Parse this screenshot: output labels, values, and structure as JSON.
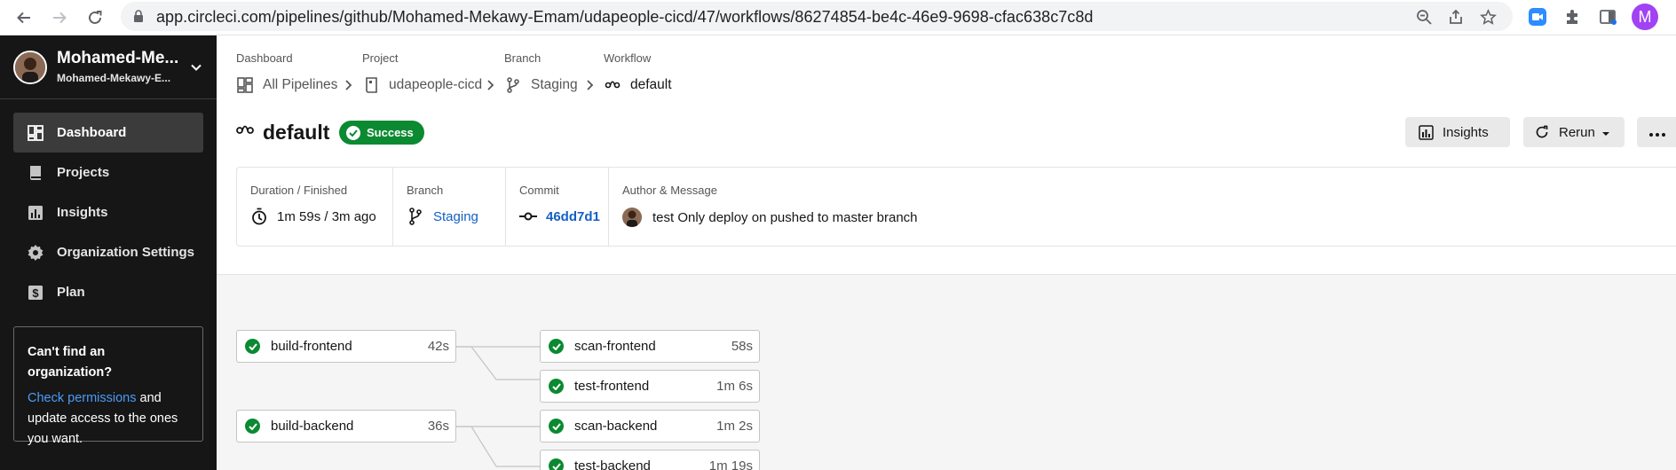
{
  "browser": {
    "url": "app.circleci.com/pipelines/github/Mohamed-Mekawy-Emam/udapeople-cicd/47/workflows/86274854-be4c-46e9-9698-cfac638c7c8d",
    "profile_initial": "M"
  },
  "sidebar": {
    "org_name": "Mohamed-Me...",
    "org_sub": "Mohamed-Mekawy-E...",
    "items": [
      {
        "label": "Dashboard",
        "icon": "dashboard-icon",
        "active": true
      },
      {
        "label": "Projects",
        "icon": "projects-icon",
        "active": false
      },
      {
        "label": "Insights",
        "icon": "insights-icon",
        "active": false
      },
      {
        "label": "Organization Settings",
        "icon": "gear-icon",
        "active": false
      },
      {
        "label": "Plan",
        "icon": "dollar-icon",
        "active": false
      }
    ],
    "card": {
      "heading": "Can't find an organization?",
      "link": "Check permissions",
      "text_after_link": " and update access to the ones you want."
    }
  },
  "breadcrumbs": [
    {
      "label": "Dashboard",
      "value": "All Pipelines",
      "icon": "grid-icon"
    },
    {
      "label": "Project",
      "value": "udapeople-cicd",
      "icon": "repo-icon"
    },
    {
      "label": "Branch",
      "value": "Staging",
      "icon": "branch-icon"
    },
    {
      "label": "Workflow",
      "value": "default",
      "icon": "workflow-icon"
    }
  ],
  "workflow": {
    "name": "default",
    "status": "Success",
    "status_color": "#0b8a31"
  },
  "actions": {
    "insights_label": "Insights",
    "rerun_label": "Rerun"
  },
  "info": {
    "duration_label": "Duration / Finished",
    "duration_value": "1m 59s / 3m ago",
    "branch_label": "Branch",
    "branch_value": "Staging",
    "commit_label": "Commit",
    "commit_value": "46dd7d1",
    "author_label": "Author & Message",
    "author_message": "test Only deploy on pushed to master branch"
  },
  "jobs": [
    {
      "name": "build-frontend",
      "duration": "42s"
    },
    {
      "name": "scan-frontend",
      "duration": "58s"
    },
    {
      "name": "test-frontend",
      "duration": "1m 6s"
    },
    {
      "name": "build-backend",
      "duration": "36s"
    },
    {
      "name": "scan-backend",
      "duration": "1m 2s"
    },
    {
      "name": "test-backend",
      "duration": "1m 19s"
    }
  ]
}
